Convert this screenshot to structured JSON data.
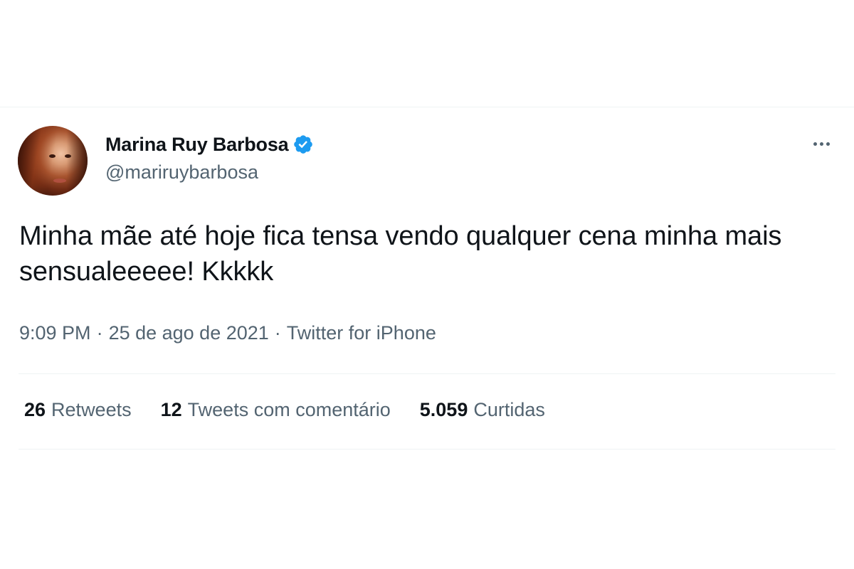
{
  "author": {
    "display_name": "Marina Ruy Barbosa",
    "handle": "@mariruybarbosa",
    "verified": true
  },
  "tweet": {
    "text": "Minha mãe até hoje fica tensa vendo qualquer cena minha mais sensualeeeee! Kkkkk",
    "time": "9:09 PM",
    "date": "25 de ago de 2021",
    "source": "Twitter for iPhone",
    "separator": "·"
  },
  "stats": [
    {
      "count": "26",
      "label": "Retweets"
    },
    {
      "count": "12",
      "label": "Tweets com comentário"
    },
    {
      "count": "5.059",
      "label": "Curtidas"
    }
  ],
  "icons": {
    "verified": "verified-badge-icon",
    "more": "more-options-icon"
  },
  "colors": {
    "text_primary": "#0f1419",
    "text_secondary": "#536471",
    "verified_blue": "#1d9bf0",
    "divider": "#eff3f4"
  }
}
